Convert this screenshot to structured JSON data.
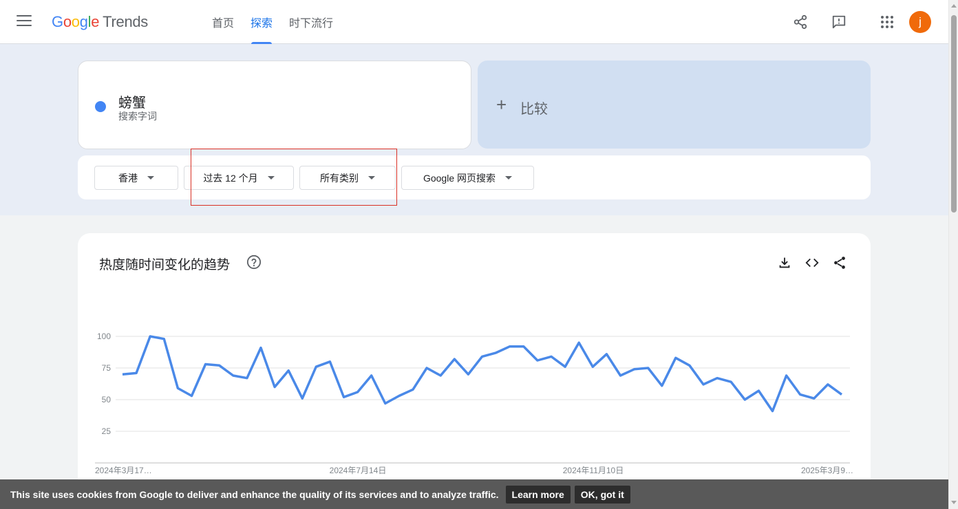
{
  "header": {
    "logo_google": [
      "G",
      "o",
      "o",
      "g",
      "l",
      "e"
    ],
    "logo_product": "Trends",
    "nav": [
      {
        "label": "首页",
        "active": false
      },
      {
        "label": "探索",
        "active": true
      },
      {
        "label": "时下流行",
        "active": false
      }
    ],
    "icons": [
      "share-icon",
      "feedback-icon",
      "apps-grid-icon"
    ],
    "avatar_letter": "j",
    "avatar_color": "#f06a0a"
  },
  "term": {
    "name": "螃蟹",
    "type": "搜索字词",
    "color": "#4285f4"
  },
  "compare": {
    "plus": "+",
    "label": "比较"
  },
  "filters": {
    "region": "香港",
    "time": "过去 12 个月",
    "category": "所有类别",
    "property": "Google 网页搜索"
  },
  "chart_section": {
    "title": "热度随时间变化的趋势",
    "icons": [
      "help-icon",
      "download-icon",
      "embed-code-icon",
      "share-icon"
    ]
  },
  "chart_data": {
    "type": "line",
    "y_ticks": [
      "100",
      "75",
      "50",
      "25"
    ],
    "ylim": [
      0,
      100
    ],
    "x_tick_labels": [
      "2024年3月17…",
      "2024年7月14日",
      "2024年11月10日",
      "2025年3月9…"
    ],
    "series": [
      {
        "color": "#4a89e8",
        "values": [
          70,
          71,
          100,
          98,
          59,
          53,
          78,
          77,
          69,
          67,
          91,
          60,
          73,
          51,
          76,
          80,
          52,
          56,
          69,
          47,
          53,
          58,
          75,
          69,
          82,
          70,
          84,
          87,
          92,
          92,
          81,
          84,
          76,
          95,
          76,
          86,
          69,
          74,
          75,
          61,
          83,
          77,
          62,
          67,
          64,
          50,
          57,
          41,
          69,
          54,
          51,
          62,
          54
        ]
      }
    ],
    "grid": true
  },
  "cookie": {
    "text": "This site uses cookies from Google to deliver and enhance the quality of its services and to analyze traffic.",
    "learn_more": "Learn more",
    "ok": "OK, got it"
  }
}
